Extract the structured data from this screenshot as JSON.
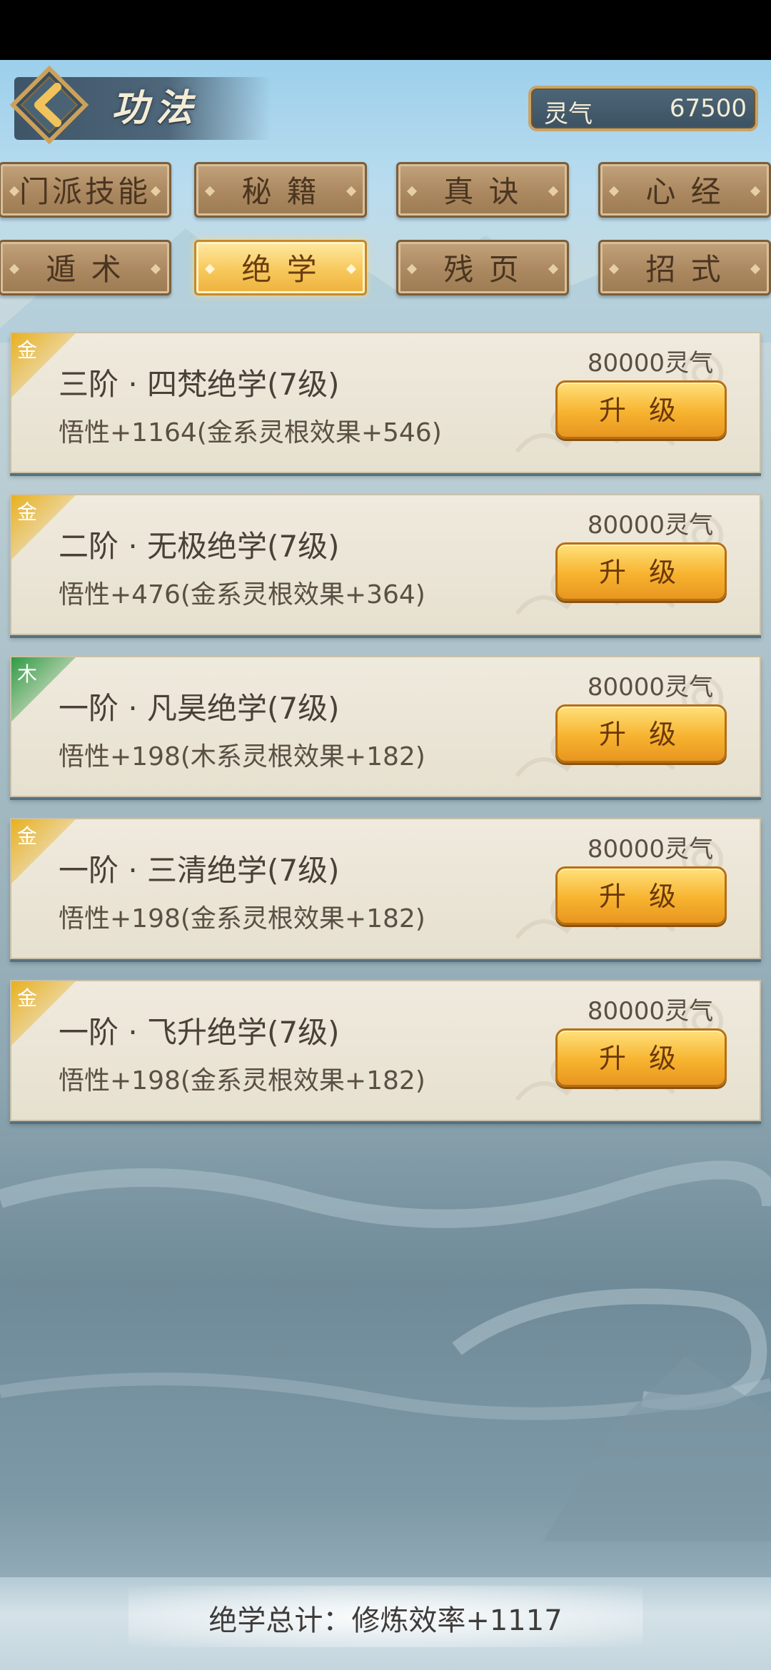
{
  "header": {
    "title": "功法",
    "spirit_label": "灵气",
    "spirit_value": "67500"
  },
  "tabs": [
    {
      "label": "门派技能",
      "active": false
    },
    {
      "label": "秘 籍",
      "active": false
    },
    {
      "label": "真 诀",
      "active": false
    },
    {
      "label": "心 经",
      "active": false
    },
    {
      "label": "遁 术",
      "active": false
    },
    {
      "label": "绝 学",
      "active": true
    },
    {
      "label": "残 页",
      "active": false
    },
    {
      "label": "招 式",
      "active": false
    }
  ],
  "skills": [
    {
      "element": "金",
      "element_color": "#e8b020",
      "title": "三阶 · 四梵绝学(7级)",
      "desc": "悟性+1164(金系灵根效果+546)",
      "cost": "80000灵气",
      "button": "升 级"
    },
    {
      "element": "金",
      "element_color": "#e8b020",
      "title": "二阶 · 无极绝学(7级)",
      "desc": "悟性+476(金系灵根效果+364)",
      "cost": "80000灵气",
      "button": "升 级"
    },
    {
      "element": "木",
      "element_color": "#2f9a44",
      "title": "一阶 · 凡昊绝学(7级)",
      "desc": "悟性+198(木系灵根效果+182)",
      "cost": "80000灵气",
      "button": "升 级"
    },
    {
      "element": "金",
      "element_color": "#e8b020",
      "title": "一阶 · 三清绝学(7级)",
      "desc": "悟性+198(金系灵根效果+182)",
      "cost": "80000灵气",
      "button": "升 级"
    },
    {
      "element": "金",
      "element_color": "#e8b020",
      "title": "一阶 · 飞升绝学(7级)",
      "desc": "悟性+198(金系灵根效果+182)",
      "cost": "80000灵气",
      "button": "升 级"
    }
  ],
  "footer": {
    "summary": "绝学总计：修炼效率+1117"
  },
  "icons": {
    "back": "chevron-left-icon",
    "diamond": "diamond-ornament-icon"
  }
}
